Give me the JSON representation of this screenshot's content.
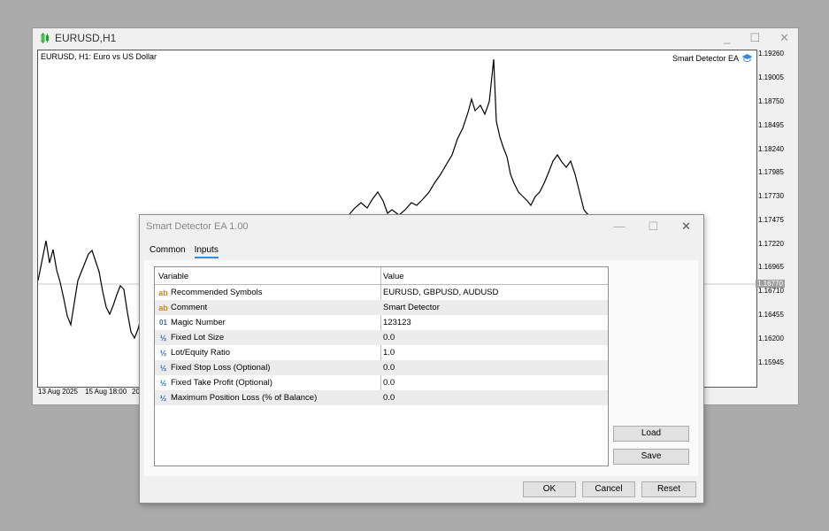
{
  "chart_window": {
    "title": "EURUSD,H1",
    "chart_label": "EURUSD, H1:  Euro vs US Dollar",
    "ea_label": "Smart Detector EA",
    "price_ticks": [
      "1.19260",
      "1.19005",
      "1.18750",
      "1.18495",
      "1.18240",
      "1.17985",
      "1.17730",
      "1.17475",
      "1.17220",
      "1.16965",
      "1.16710",
      "1.16455",
      "1.16200",
      "1.15945"
    ],
    "current_price": "1.16770",
    "time_ticks": [
      "13 Aug 2025",
      "15 Aug 18:00",
      "20"
    ]
  },
  "dialog": {
    "title": "Smart Detector EA 1.00",
    "tabs": [
      "Common",
      "Inputs"
    ],
    "active_tab": "Inputs",
    "columns": {
      "variable": "Variable",
      "value": "Value"
    },
    "rows": [
      {
        "icon": "ab",
        "variable": "Recommended Symbols",
        "value": "EURUSD, GBPUSD, AUDUSD"
      },
      {
        "icon": "ab",
        "variable": "Comment",
        "value": "Smart Detector"
      },
      {
        "icon": "01",
        "variable": "Magic Number",
        "value": "123123"
      },
      {
        "icon": "½",
        "variable": "Fixed Lot Size",
        "value": "0.0"
      },
      {
        "icon": "½",
        "variable": "Lot/Equity Ratio",
        "value": "1.0"
      },
      {
        "icon": "½",
        "variable": "Fixed Stop Loss (Optional)",
        "value": "0.0"
      },
      {
        "icon": "½",
        "variable": "Fixed Take Profit (Optional)",
        "value": "0.0"
      },
      {
        "icon": "½",
        "variable": "Maximum Position Loss (% of Balance)",
        "value": "0.0"
      }
    ],
    "buttons": {
      "load": "Load",
      "save": "Save",
      "ok": "OK",
      "cancel": "Cancel",
      "reset": "Reset"
    }
  },
  "colors": {
    "chart_bg": "#ffffff",
    "dialog_bg": "#f0f0f0",
    "accent": "#3a8ad6",
    "string_icon": "#d0831e",
    "numeric_icon": "#2b6fb5"
  }
}
